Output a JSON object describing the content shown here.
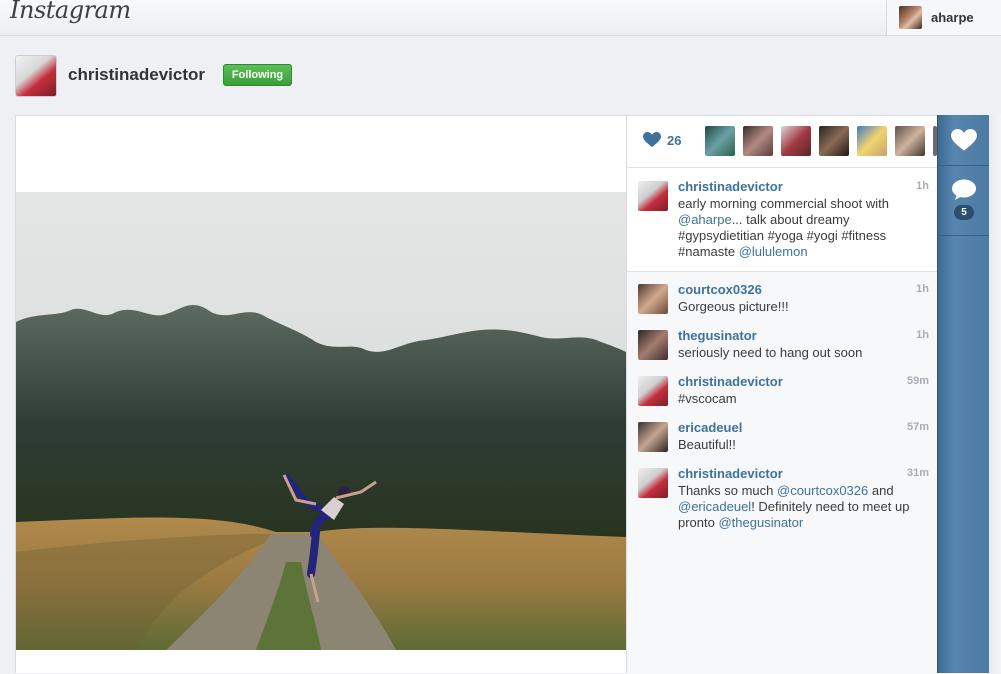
{
  "header": {
    "logo_text": "Instagram",
    "username": "aharpe"
  },
  "profile": {
    "username": "christinadevictor",
    "follow_status": "Following"
  },
  "likes": {
    "count": "26"
  },
  "caption": {
    "username": "christinadevictor",
    "time": "1h",
    "parts": [
      {
        "t": "early morning commercial shoot with ",
        "m": false
      },
      {
        "t": "@aharpe",
        "m": true
      },
      {
        "t": "... talk about dreamy #gypsydietitian #yoga #yogi #fitness #namaste ",
        "m": false
      },
      {
        "t": "@lululemon",
        "m": true
      }
    ]
  },
  "comments": [
    {
      "username": "courtcox0326",
      "time": "1h",
      "parts": [
        {
          "t": "Gorgeous picture!!!",
          "m": false
        }
      ]
    },
    {
      "username": "thegusinator",
      "time": "1h",
      "parts": [
        {
          "t": "seriously need to hang out soon",
          "m": false
        }
      ]
    },
    {
      "username": "christinadevictor",
      "time": "59m",
      "parts": [
        {
          "t": "#vscocam",
          "m": false
        }
      ]
    },
    {
      "username": "ericadeuel",
      "time": "57m",
      "parts": [
        {
          "t": "Beautiful!!",
          "m": false
        }
      ]
    },
    {
      "username": "christinadevictor",
      "time": "31m",
      "parts": [
        {
          "t": "Thanks so much ",
          "m": false
        },
        {
          "t": "@courtcox0326",
          "m": true
        },
        {
          "t": " and ",
          "m": false
        },
        {
          "t": "@ericadeuel",
          "m": true
        },
        {
          "t": "! Definitely need to meet up pronto ",
          "m": false
        },
        {
          "t": "@thegusinator",
          "m": true
        }
      ]
    }
  ],
  "actions": {
    "comment_count": "5"
  },
  "colors": {
    "link": "#3f729b",
    "following_green": "#4cae4a",
    "strip_blue": "#4d7aa3"
  },
  "icons": [
    "heart-icon",
    "comment-bubble-icon"
  ]
}
